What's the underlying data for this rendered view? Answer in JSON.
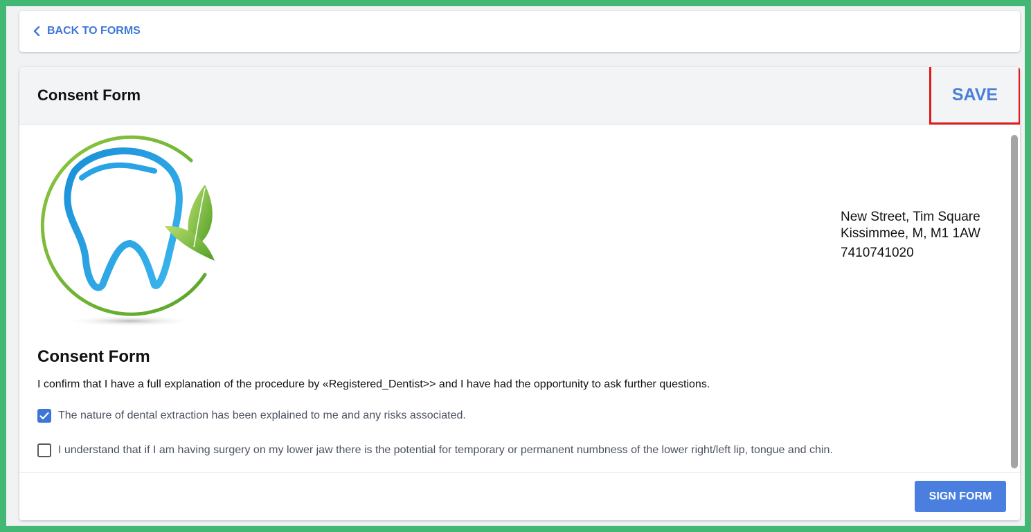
{
  "nav": {
    "back_label": "BACK TO FORMS"
  },
  "form": {
    "title": "Consent Form",
    "save_label": "SAVE",
    "address": {
      "line1": "New Street, Tim Square",
      "line2": "Kissimmee, M, M1 1AW",
      "phone": "7410741020"
    },
    "content_title": "Consent Form",
    "intro": "I confirm that I have a full explanation of the procedure by «Registered_Dentist>> and I have had the opportunity to ask further questions.",
    "checks": [
      {
        "label": "The nature of dental extraction has been explained to me and any risks associated.",
        "checked": true
      },
      {
        "label": "I understand that if I am having surgery on my lower jaw there is the potential for temporary or permanent numbness of the lower right/left lip, tongue and chin.",
        "checked": false
      }
    ],
    "sign_label": "SIGN FORM"
  },
  "colors": {
    "accent": "#3e76d8",
    "highlight_border": "#e0191b",
    "outer_border": "#43b874"
  }
}
